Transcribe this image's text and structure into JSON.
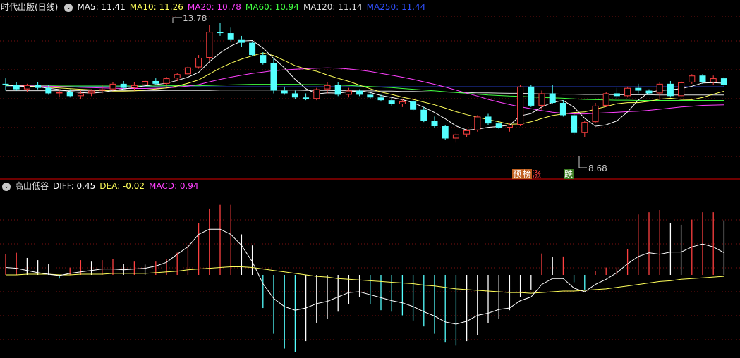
{
  "colors": {
    "up": "#ff4040",
    "down": "#54ffff",
    "grid": "#7a1010",
    "divider": "#b00000",
    "ma5": "#ffffff",
    "ma10": "#ffff5a",
    "ma20": "#ff40ff",
    "ma60": "#40ff40",
    "ma120": "#dddddd",
    "ma250": "#3050ff",
    "diff": "#ffffff",
    "dea": "#ffff5a",
    "macd": "#ff40ff",
    "annotation": "#cccccc"
  },
  "top_panel": {
    "name": "时代出版(日线)",
    "indicators": [
      {
        "key": "ma5",
        "label": "MA5: 11.41"
      },
      {
        "key": "ma10",
        "label": "MA10: 11.26"
      },
      {
        "key": "ma20",
        "label": "MA20: 10.78"
      },
      {
        "key": "ma60",
        "label": "MA60: 10.94"
      },
      {
        "key": "ma120",
        "label": "MA120: 11.14"
      },
      {
        "key": "ma250",
        "label": "MA250: 11.44"
      }
    ],
    "high_label": "13.78",
    "low_label": "8.68",
    "tags": [
      {
        "text": "预",
        "bg": "#c06020",
        "color": "#ffffff"
      },
      {
        "text": "榜",
        "bg": "#c06020",
        "color": "#ffffff"
      },
      {
        "text": "涨",
        "bg": "",
        "color": "#ff4040"
      },
      {
        "text": "跌",
        "bg": "#3a7a20",
        "color": "#ffffff"
      }
    ]
  },
  "bottom_panel": {
    "name": "高山低谷",
    "indicators": [
      {
        "key": "diff",
        "label": "DIFF: 0.45"
      },
      {
        "key": "dea",
        "label": "DEA: -0.02"
      },
      {
        "key": "macd",
        "label": "MACD: 0.94"
      }
    ]
  },
  "chart_data": [
    {
      "type": "candlestick",
      "title": "时代出版(日线)",
      "ylim": [
        8.3,
        14.2
      ],
      "candles": [
        [
          11.55,
          11.75,
          11.3,
          11.5
        ],
        [
          11.5,
          11.6,
          11.3,
          11.35
        ],
        [
          11.35,
          11.55,
          11.25,
          11.5
        ],
        [
          11.5,
          11.6,
          11.35,
          11.4
        ],
        [
          11.4,
          11.5,
          11.15,
          11.2
        ],
        [
          11.2,
          11.35,
          11.05,
          11.25
        ],
        [
          11.25,
          11.35,
          11.05,
          11.1
        ],
        [
          11.1,
          11.3,
          11.0,
          11.2
        ],
        [
          11.2,
          11.35,
          11.1,
          11.3
        ],
        [
          11.3,
          11.5,
          11.2,
          11.35
        ],
        [
          11.35,
          11.6,
          11.3,
          11.55
        ],
        [
          11.55,
          11.65,
          11.35,
          11.4
        ],
        [
          11.4,
          11.6,
          11.3,
          11.5
        ],
        [
          11.5,
          11.7,
          11.45,
          11.65
        ],
        [
          11.65,
          11.75,
          11.5,
          11.55
        ],
        [
          11.55,
          11.8,
          11.45,
          11.75
        ],
        [
          11.75,
          11.95,
          11.65,
          11.9
        ],
        [
          11.9,
          12.2,
          11.85,
          12.15
        ],
        [
          12.15,
          12.6,
          12.1,
          12.5
        ],
        [
          12.5,
          13.7,
          12.4,
          13.45
        ],
        [
          13.45,
          13.78,
          13.3,
          13.4
        ],
        [
          13.4,
          13.6,
          13.1,
          13.15
        ],
        [
          13.15,
          13.3,
          12.9,
          13.05
        ],
        [
          13.05,
          13.1,
          12.55,
          12.6
        ],
        [
          12.6,
          12.7,
          12.25,
          12.3
        ],
        [
          12.3,
          12.5,
          11.2,
          11.3
        ],
        [
          11.3,
          11.45,
          11.15,
          11.2
        ],
        [
          11.2,
          11.3,
          11.0,
          11.05
        ],
        [
          11.05,
          11.2,
          10.95,
          11.0
        ],
        [
          11.0,
          11.4,
          10.95,
          11.35
        ],
        [
          11.35,
          11.6,
          11.2,
          11.5
        ],
        [
          11.5,
          11.6,
          11.1,
          11.15
        ],
        [
          11.15,
          11.4,
          11.05,
          11.3
        ],
        [
          11.3,
          11.35,
          11.1,
          11.15
        ],
        [
          11.15,
          11.25,
          11.0,
          11.05
        ],
        [
          11.05,
          11.15,
          10.9,
          10.95
        ],
        [
          10.95,
          11.05,
          10.75,
          10.8
        ],
        [
          10.8,
          11.0,
          10.7,
          10.9
        ],
        [
          10.9,
          10.95,
          10.55,
          10.6
        ],
        [
          10.6,
          10.7,
          10.15,
          10.2
        ],
        [
          10.2,
          10.35,
          9.95,
          10.0
        ],
        [
          10.0,
          10.05,
          9.5,
          9.55
        ],
        [
          9.55,
          9.75,
          9.4,
          9.7
        ],
        [
          9.7,
          9.9,
          9.6,
          9.85
        ],
        [
          9.85,
          10.4,
          9.8,
          10.35
        ],
        [
          10.35,
          10.45,
          10.05,
          10.1
        ],
        [
          10.1,
          10.2,
          9.9,
          9.95
        ],
        [
          9.95,
          10.1,
          9.8,
          10.05
        ],
        [
          10.05,
          11.5,
          10.0,
          11.45
        ],
        [
          11.45,
          11.5,
          10.7,
          10.75
        ],
        [
          10.75,
          11.3,
          10.6,
          11.2
        ],
        [
          11.2,
          11.5,
          10.8,
          10.85
        ],
        [
          10.85,
          10.95,
          10.35,
          10.4
        ],
        [
          10.4,
          10.5,
          9.7,
          9.75
        ],
        [
          9.75,
          10.2,
          9.6,
          10.15
        ],
        [
          10.15,
          10.85,
          10.1,
          10.75
        ],
        [
          10.75,
          11.25,
          10.7,
          11.2
        ],
        [
          11.2,
          11.4,
          11.0,
          11.1
        ],
        [
          11.1,
          11.45,
          11.05,
          11.4
        ],
        [
          11.4,
          11.55,
          11.2,
          11.3
        ],
        [
          11.3,
          11.35,
          11.15,
          11.2
        ],
        [
          11.2,
          11.6,
          11.0,
          11.55
        ],
        [
          11.55,
          11.65,
          11.05,
          11.1
        ],
        [
          11.1,
          11.65,
          11.05,
          11.6
        ],
        [
          11.6,
          11.9,
          11.55,
          11.85
        ],
        [
          11.85,
          11.9,
          11.55,
          11.6
        ],
        [
          11.6,
          11.85,
          11.5,
          11.75
        ],
        [
          11.75,
          11.8,
          11.45,
          11.5
        ]
      ],
      "ma5": [
        11.5,
        11.47,
        11.45,
        11.44,
        11.39,
        11.34,
        11.27,
        11.23,
        11.21,
        11.24,
        11.3,
        11.36,
        11.41,
        11.48,
        11.52,
        11.57,
        11.67,
        11.79,
        11.97,
        12.35,
        12.68,
        12.93,
        13.11,
        13.13,
        12.86,
        12.48,
        12.13,
        11.71,
        11.37,
        11.18,
        11.22,
        11.21,
        11.26,
        11.29,
        11.23,
        11.12,
        11.05,
        10.97,
        10.86,
        10.69,
        10.5,
        10.27,
        10.01,
        9.86,
        9.89,
        9.96,
        9.99,
        10.04,
        10.38,
        10.46,
        10.7,
        10.87,
        10.94,
        10.69,
        10.29,
        10.0,
        10.05,
        10.19,
        10.52,
        10.95,
        11.24,
        11.31,
        11.33,
        11.37,
        11.46,
        11.58,
        11.59,
        11.57
      ],
      "ma10": [
        11.5,
        11.48,
        11.46,
        11.45,
        11.42,
        11.4,
        11.37,
        11.35,
        11.33,
        11.31,
        11.28,
        11.28,
        11.29,
        11.32,
        11.36,
        11.4,
        11.47,
        11.57,
        11.69,
        11.91,
        12.12,
        12.3,
        12.45,
        12.57,
        12.68,
        12.58,
        12.4,
        12.21,
        12.09,
        12.01,
        11.87,
        11.75,
        11.64,
        11.5,
        11.37,
        11.25,
        11.16,
        11.06,
        10.98,
        10.88,
        10.78,
        10.66,
        10.53,
        10.42,
        10.33,
        10.24,
        10.16,
        10.07,
        10.08,
        10.16,
        10.28,
        10.39,
        10.45,
        10.5,
        10.52,
        10.62,
        10.72,
        10.82,
        10.86,
        10.86,
        10.91,
        10.99,
        11.02,
        10.98,
        10.97,
        11.05,
        11.17,
        11.28
      ],
      "ma20": [
        11.5,
        11.49,
        11.48,
        11.47,
        11.46,
        11.45,
        11.44,
        11.42,
        11.41,
        11.4,
        11.39,
        11.38,
        11.38,
        11.38,
        11.39,
        11.4,
        11.43,
        11.47,
        11.52,
        11.62,
        11.71,
        11.79,
        11.86,
        11.93,
        11.98,
        12.03,
        12.06,
        12.08,
        12.1,
        12.12,
        12.13,
        12.12,
        12.09,
        12.05,
        12.0,
        11.93,
        11.86,
        11.79,
        11.71,
        11.62,
        11.53,
        11.43,
        11.32,
        11.21,
        11.1,
        10.98,
        10.88,
        10.79,
        10.71,
        10.64,
        10.57,
        10.51,
        10.47,
        10.45,
        10.45,
        10.47,
        10.49,
        10.51,
        10.53,
        10.55,
        10.58,
        10.62,
        10.66,
        10.7,
        10.73,
        10.76,
        10.77,
        10.78
      ],
      "ma60": [
        11.48,
        11.48,
        11.48,
        11.48,
        11.48,
        11.47,
        11.47,
        11.47,
        11.47,
        11.47,
        11.47,
        11.47,
        11.47,
        11.47,
        11.47,
        11.48,
        11.48,
        11.48,
        11.48,
        11.49,
        11.5,
        11.51,
        11.52,
        11.53,
        11.53,
        11.53,
        11.53,
        11.53,
        11.52,
        11.52,
        11.51,
        11.5,
        11.49,
        11.47,
        11.45,
        11.43,
        11.41,
        11.38,
        11.35,
        11.32,
        11.29,
        11.26,
        11.23,
        11.2,
        11.17,
        11.14,
        11.12,
        11.1,
        11.09,
        11.07,
        11.05,
        11.04,
        11.02,
        11.0,
        10.98,
        10.97,
        10.96,
        10.95,
        10.95,
        10.94,
        10.94,
        10.94,
        10.94,
        10.94,
        10.94,
        10.94,
        10.94,
        10.94
      ],
      "ma120": [
        11.3,
        11.3,
        11.3,
        11.3,
        11.3,
        11.3,
        11.3,
        11.3,
        11.3,
        11.3,
        11.3,
        11.3,
        11.3,
        11.3,
        11.3,
        11.31,
        11.31,
        11.31,
        11.31,
        11.31,
        11.32,
        11.32,
        11.32,
        11.32,
        11.32,
        11.32,
        11.32,
        11.32,
        11.31,
        11.31,
        11.31,
        11.3,
        11.3,
        11.29,
        11.29,
        11.28,
        11.28,
        11.27,
        11.27,
        11.26,
        11.25,
        11.25,
        11.24,
        11.23,
        11.22,
        11.22,
        11.21,
        11.2,
        11.2,
        11.19,
        11.18,
        11.18,
        11.17,
        11.17,
        11.16,
        11.16,
        11.16,
        11.15,
        11.15,
        11.15,
        11.15,
        11.14,
        11.14,
        11.14,
        11.14,
        11.14,
        11.14,
        11.14
      ],
      "ma250": [
        11.44,
        11.44,
        11.44,
        11.44,
        11.44,
        11.44,
        11.44,
        11.44,
        11.44,
        11.44,
        11.44,
        11.44,
        11.44,
        11.44,
        11.44,
        11.44,
        11.44,
        11.44,
        11.44,
        11.44,
        11.44,
        11.44,
        11.44,
        11.44,
        11.44,
        11.44,
        11.44,
        11.44,
        11.44,
        11.44,
        11.44,
        11.44,
        11.44,
        11.44,
        11.44,
        11.44,
        11.44,
        11.44,
        11.44,
        11.44,
        11.44,
        11.44,
        11.44,
        11.44,
        11.44,
        11.44,
        11.44,
        11.44,
        11.44,
        11.44,
        11.44,
        11.44,
        11.44,
        11.44,
        11.44,
        11.44,
        11.44,
        11.44,
        11.44,
        11.44,
        11.44,
        11.44,
        11.44,
        11.44,
        11.44,
        11.44,
        11.44,
        11.44
      ]
    },
    {
      "type": "bar",
      "title": "高山低谷",
      "ylim": [
        -1.1,
        1.1
      ],
      "diff": [
        0.1,
        0.09,
        0.06,
        0.03,
        0.01,
        -0.01,
        0.02,
        0.04,
        0.06,
        0.08,
        0.08,
        0.07,
        0.08,
        0.09,
        0.12,
        0.17,
        0.28,
        0.38,
        0.55,
        0.62,
        0.62,
        0.55,
        0.4,
        0.18,
        -0.12,
        -0.32,
        -0.43,
        -0.48,
        -0.45,
        -0.39,
        -0.36,
        -0.3,
        -0.24,
        -0.23,
        -0.27,
        -0.31,
        -0.35,
        -0.38,
        -0.43,
        -0.5,
        -0.56,
        -0.64,
        -0.67,
        -0.63,
        -0.55,
        -0.52,
        -0.47,
        -0.45,
        -0.35,
        -0.3,
        -0.13,
        -0.05,
        -0.05,
        -0.18,
        -0.23,
        -0.13,
        -0.06,
        0.03,
        0.15,
        0.25,
        0.3,
        0.28,
        0.31,
        0.31,
        0.38,
        0.42,
        0.38,
        0.3
      ],
      "dea": [
        0.0,
        0.0,
        0.01,
        0.01,
        0.01,
        0.0,
        0.0,
        0.01,
        0.01,
        0.01,
        0.02,
        0.02,
        0.02,
        0.02,
        0.03,
        0.04,
        0.05,
        0.07,
        0.08,
        0.09,
        0.1,
        0.11,
        0.11,
        0.1,
        0.08,
        0.06,
        0.04,
        0.02,
        0.0,
        -0.02,
        -0.03,
        -0.05,
        -0.06,
        -0.07,
        -0.08,
        -0.09,
        -0.1,
        -0.11,
        -0.12,
        -0.14,
        -0.15,
        -0.17,
        -0.19,
        -0.2,
        -0.21,
        -0.22,
        -0.23,
        -0.24,
        -0.24,
        -0.25,
        -0.24,
        -0.23,
        -0.22,
        -0.22,
        -0.21,
        -0.2,
        -0.19,
        -0.17,
        -0.15,
        -0.13,
        -0.11,
        -0.09,
        -0.08,
        -0.06,
        -0.05,
        -0.04,
        -0.03,
        -0.02
      ],
      "macd": [
        0.28,
        0.3,
        0.23,
        0.2,
        0.15,
        -0.05,
        0.1,
        0.2,
        0.18,
        0.2,
        0.22,
        0.15,
        0.18,
        0.14,
        0.18,
        0.22,
        0.3,
        0.4,
        0.7,
        0.9,
        0.95,
        0.95,
        0.55,
        0.4,
        -0.45,
        -0.8,
        -1.0,
        -1.05,
        -0.9,
        -0.65,
        -0.6,
        -0.5,
        -0.4,
        -0.3,
        -0.4,
        -0.48,
        -0.5,
        -0.55,
        -0.62,
        -0.7,
        -0.8,
        -0.92,
        -0.96,
        -0.9,
        -0.82,
        -0.66,
        -0.6,
        -0.48,
        -0.3,
        -0.2,
        0.29,
        0.24,
        0.25,
        -0.1,
        -0.2,
        0.05,
        0.1,
        0.1,
        0.35,
        0.82,
        0.85,
        0.88,
        0.7,
        0.68,
        0.75,
        0.85,
        0.85,
        0.74
      ]
    }
  ]
}
